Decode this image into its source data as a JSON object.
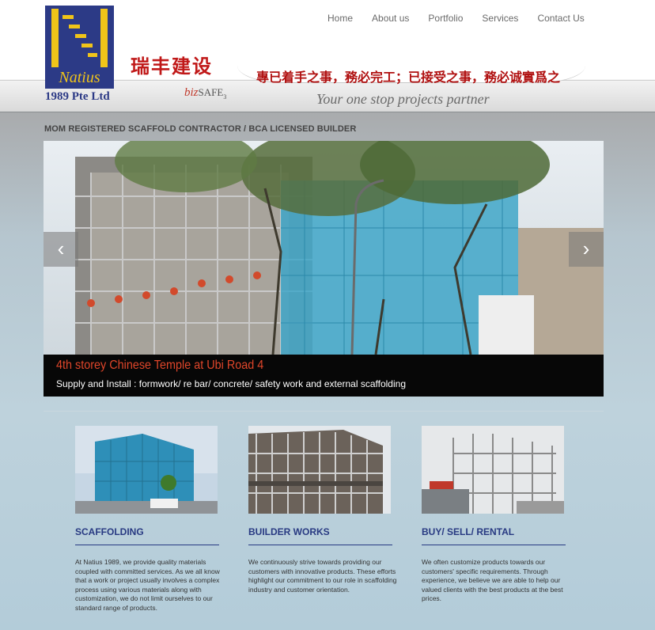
{
  "header": {
    "logo": {
      "name": "Natius",
      "sub": "1989 Pte Ltd"
    },
    "chinese_name": "瑞丰建设",
    "bizsafe": {
      "biz": "biz",
      "safe": "SAFE",
      "level": "3"
    },
    "motto": "專已着手之事，務必完工；已接受之事，務必诚實爲之",
    "tagline": "Your one stop projects partner",
    "nav": [
      "Home",
      "About us",
      "Portfolio",
      "Services",
      "Contact Us"
    ]
  },
  "page_heading": "MOM REGISTERED SCAFFOLD CONTRACTOR / BCA LICENSED BUILDER",
  "slider": {
    "caption_title": "4th storey Chinese Temple at Ubi Road 4",
    "caption_text": "Supply and Install : formwork/ re bar/ concrete/ safety work and external scaffolding",
    "prev_icon": "‹",
    "next_icon": "›"
  },
  "columns": [
    {
      "title": "SCAFFOLDING",
      "text": "At Natius 1989, we provide quality materials coupled with committed services. As we all know that a work or project usually involves a complex process using various materials along with customization, we do not limit ourselves to our standard range of products."
    },
    {
      "title": "BUILDER WORKS",
      "text": "We continuously strive towards providing our customers with innovative products. These efforts highlight our commitment to our role in scaffolding industry and customer orientation."
    },
    {
      "title": "BUY/ SELL/ RENTAL",
      "text": "We often customize products towards our customers' specific requirements. Through experience, we believe we are able to help our valued clients with the best products at the best prices."
    }
  ]
}
